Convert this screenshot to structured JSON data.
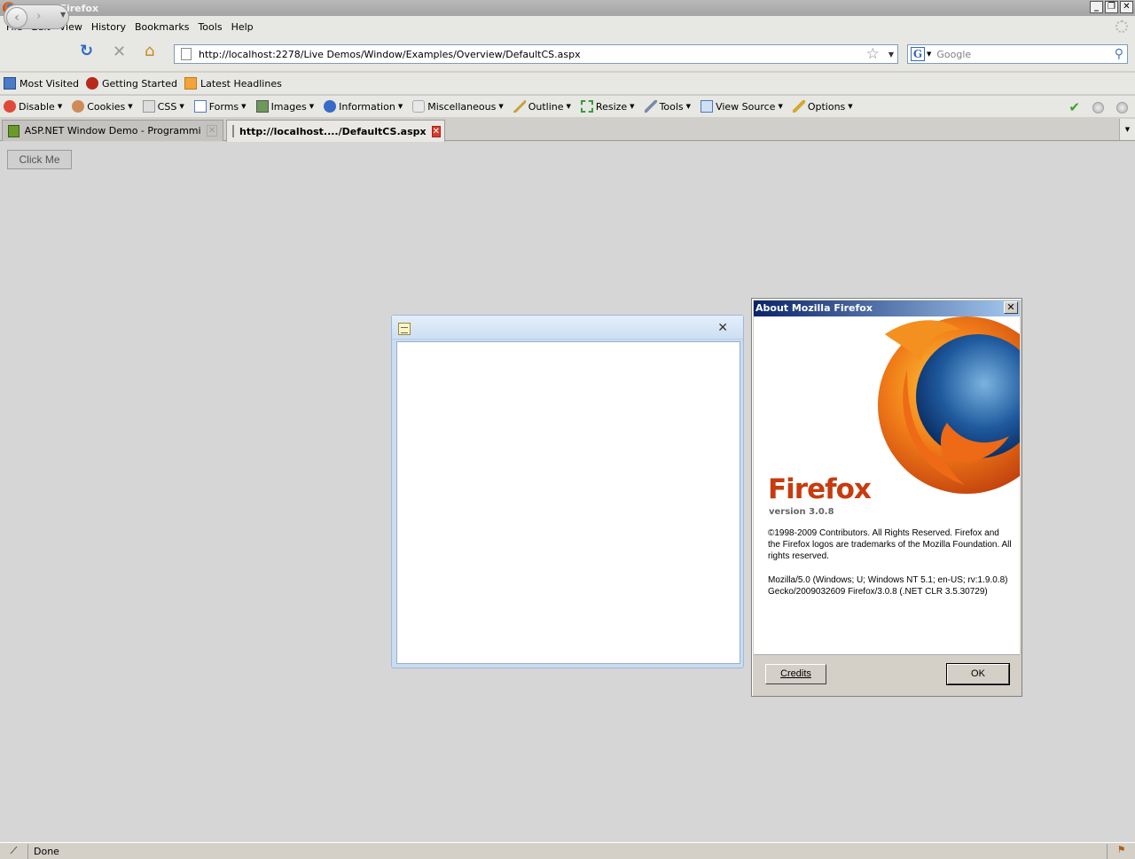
{
  "window": {
    "title": "Mozilla Firefox"
  },
  "menu": [
    "File",
    "Edit",
    "View",
    "History",
    "Bookmarks",
    "Tools",
    "Help"
  ],
  "nav": {
    "url": "http://localhost:2278/Live Demos/Window/Examples/Overview/DefaultCS.aspx",
    "search_placeholder": "Google"
  },
  "bookmarks": [
    "Most Visited",
    "Getting Started",
    "Latest Headlines"
  ],
  "devbar": [
    "Disable",
    "Cookies",
    "CSS",
    "Forms",
    "Images",
    "Information",
    "Miscellaneous",
    "Outline",
    "Resize",
    "Tools",
    "View Source",
    "Options"
  ],
  "tabs": [
    "ASP.NET Window Demo - Programming ...",
    "http://localhost..../DefaultCS.aspx"
  ],
  "page": {
    "button_label": "Click Me"
  },
  "about": {
    "title": "About Mozilla Firefox",
    "product": "Firefox",
    "version": "version 3.0.8",
    "copyright": "©1998-2009 Contributors. All Rights Reserved. Firefox and the Firefox logos are trademarks of the Mozilla Foundation. All rights reserved.",
    "user_agent": "Mozilla/5.0 (Windows; U; Windows NT 5.1; en-US; rv:1.9.0.8) Gecko/2009032609 Firefox/3.0.8 (.NET CLR 3.5.30729)",
    "credits_label": "Credits",
    "ok_label": "OK"
  },
  "status": {
    "text": "Done"
  }
}
